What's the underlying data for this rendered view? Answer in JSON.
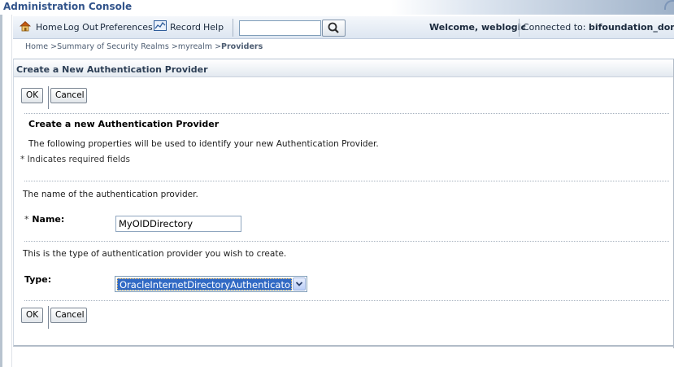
{
  "app": {
    "title": "Administration Console"
  },
  "toolbar": {
    "home": "Home",
    "logout": "Log Out",
    "preferences": "Preferences",
    "record": "Record",
    "help": "Help",
    "search_value": "",
    "welcome": "Welcome, weblogic",
    "connected_label": "Connected to:",
    "domain": "bifoundation_domai"
  },
  "breadcrumb": {
    "items": [
      "Home",
      "Summary of Security Realms",
      "myrealm"
    ],
    "separator": ">",
    "current": "Providers"
  },
  "panel": {
    "title": "Create a New Authentication Provider",
    "ok": "OK",
    "cancel": "Cancel",
    "section_title": "Create a new Authentication Provider",
    "section_desc": "The following properties will be used to identify your new Authentication Provider.",
    "required_note": "* Indicates required fields",
    "name_desc": "The name of the authentication provider.",
    "name_req": "*",
    "name_label": "Name:",
    "name_value": "MyOIDDirectory",
    "type_desc": "This is the type of authentication provider you wish to create.",
    "type_label": "Type:",
    "type_value": "OracleInternetDirectoryAuthenticator"
  },
  "colors": {
    "title": "#31538a",
    "selected": "#316ac5"
  },
  "icons": [
    "home-icon",
    "record-icon",
    "search-icon",
    "chevron-down-icon"
  ]
}
